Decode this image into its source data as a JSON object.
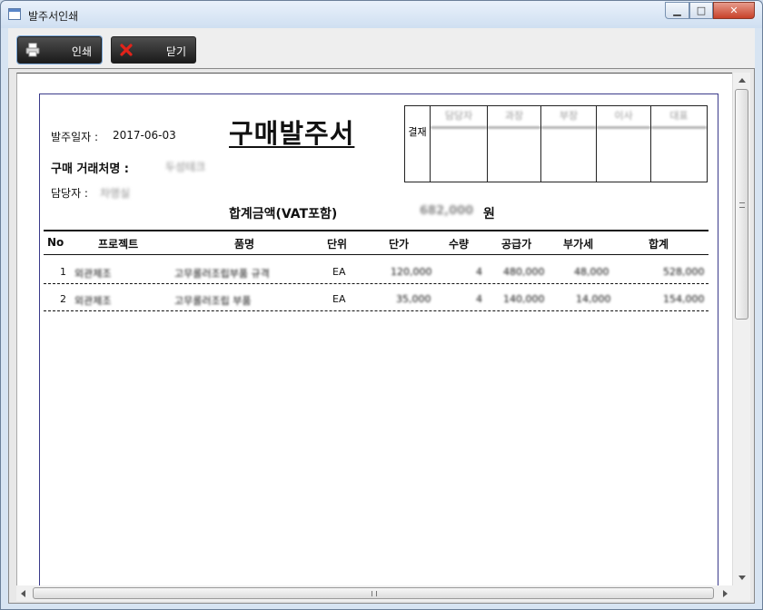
{
  "window": {
    "title": "발주서인쇄",
    "min_icon": "minimize-icon",
    "max_icon": "maximize-icon",
    "close_icon": "close-icon"
  },
  "toolbar": {
    "print_label": "인쇄",
    "print_icon": "printer-icon",
    "close_label": "닫기",
    "close_icon": "x-icon"
  },
  "document": {
    "title": "구매발주서",
    "order_date_label": "발주일자 :",
    "order_date": "2017-06-03",
    "vendor_label": "구매 거래처명 :",
    "vendor": "두성테크",
    "manager_label": "담당자 :",
    "manager": "차영실",
    "total_label": "합계금액(VAT포함)",
    "total_value": "682,000",
    "total_unit": "원",
    "approval": {
      "label": "결재",
      "roles": [
        "담당자",
        "과장",
        "부장",
        "이사",
        "대표"
      ]
    }
  },
  "table": {
    "headers": [
      "No",
      "프로젝트",
      "품명",
      "단위",
      "단가",
      "수량",
      "공급가",
      "부가세",
      "합계"
    ],
    "rows": [
      {
        "no": "1",
        "project": "외관제조",
        "item": "고무롤러조립부품 규격",
        "unit": "EA",
        "price": "120,000",
        "qty": "4",
        "supply": "480,000",
        "vat": "48,000",
        "total": "528,000"
      },
      {
        "no": "2",
        "project": "외관제조",
        "item": "고무롤러조립 부품",
        "unit": "EA",
        "price": "35,000",
        "qty": "4",
        "supply": "140,000",
        "vat": "14,000",
        "total": "154,000"
      }
    ]
  }
}
